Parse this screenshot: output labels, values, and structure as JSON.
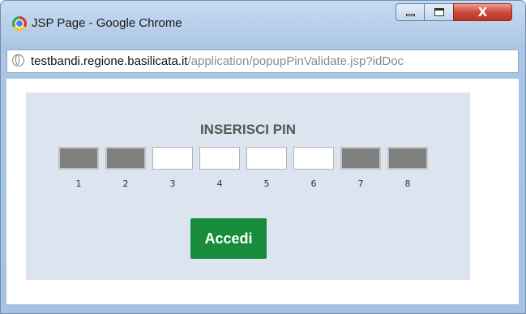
{
  "window": {
    "title": "JSP Page - Google Chrome",
    "close_glyph": "X"
  },
  "address_bar": {
    "host": "testbandi.regione.basilicata.it",
    "path": "/application/popupPinValidate.jsp?idDoc"
  },
  "pin_form": {
    "heading": "INSERISCI PIN",
    "fields": [
      {
        "label": "1",
        "enabled": false,
        "value": ""
      },
      {
        "label": "2",
        "enabled": false,
        "value": ""
      },
      {
        "label": "3",
        "enabled": true,
        "value": ""
      },
      {
        "label": "4",
        "enabled": true,
        "value": ""
      },
      {
        "label": "5",
        "enabled": true,
        "value": ""
      },
      {
        "label": "6",
        "enabled": true,
        "value": ""
      },
      {
        "label": "7",
        "enabled": false,
        "value": ""
      },
      {
        "label": "8",
        "enabled": false,
        "value": ""
      }
    ],
    "submit_label": "Accedi"
  },
  "colors": {
    "panel_background": "#dce4ef",
    "disabled_field": "#808080",
    "submit_button": "#178d3b"
  }
}
